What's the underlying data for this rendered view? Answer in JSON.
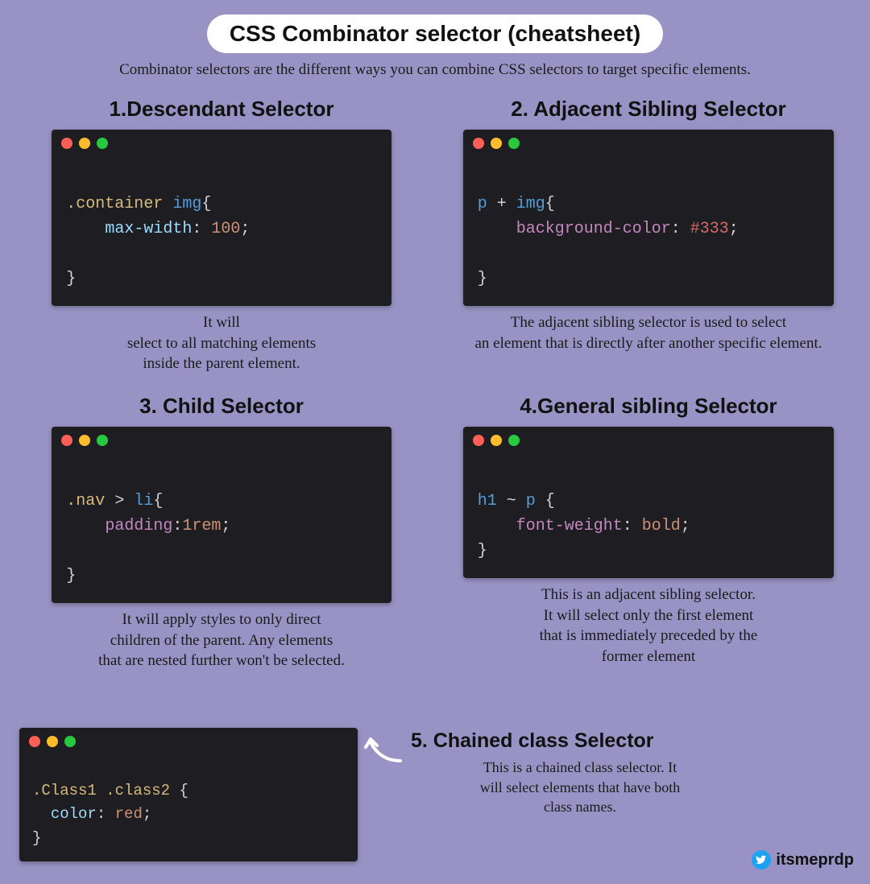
{
  "header": {
    "title": "CSS Combinator selector (cheatsheet)",
    "subtitle": "Combinator selectors are the different ways you can combine CSS selectors to target specific elements."
  },
  "sections": [
    {
      "title": "1.Descendant Selector",
      "code": {
        "sel_class": ".container",
        "sel_tag": "img",
        "open": "{",
        "prop": "max-width",
        "colon": ":",
        "val": "100",
        "semi": ";",
        "close": "}"
      },
      "desc": "It will\nselect to all matching elements\ninside the parent element."
    },
    {
      "title": "2. Adjacent Sibling Selector",
      "code": {
        "sel_a": "p",
        "op": "+",
        "sel_b": "img",
        "open": "{",
        "prop": "background-color",
        "colon": ":",
        "val": "#333",
        "semi": ";",
        "close": "}"
      },
      "desc": "The adjacent sibling selector is used to select\nan element that is directly after another specific element."
    },
    {
      "title": "3. Child Selector",
      "code": {
        "sel_class": ".nav",
        "op": ">",
        "sel_tag": "li",
        "open": "{",
        "prop": "padding",
        "colon": ":",
        "val": "1rem",
        "semi": ";",
        "close": "}"
      },
      "desc": "It will apply styles to only direct\nchildren of the parent. Any elements\nthat are nested further won't be selected."
    },
    {
      "title": "4.General sibling Selector",
      "code": {
        "sel_a": "h1",
        "op": "~",
        "sel_b": "p",
        "open": "{",
        "prop": "font-weight",
        "colon": ":",
        "val": "bold",
        "semi": ";",
        "close": "}"
      },
      "desc": "This is an adjacent sibling selector.\nIt will select only the first element\nthat is immediately preceded by the\nformer element"
    }
  ],
  "section5": {
    "title": "5. Chained class Selector",
    "code": {
      "sel_a": ".Class1",
      "sel_b": ".class2",
      "open": "{",
      "prop": "color",
      "colon": ":",
      "val": "red",
      "semi": ";",
      "close": "}"
    },
    "desc": "This is a chained class selector. It\nwill select elements that have both\nclass names."
  },
  "credit": {
    "handle": "itsmeprdp"
  }
}
